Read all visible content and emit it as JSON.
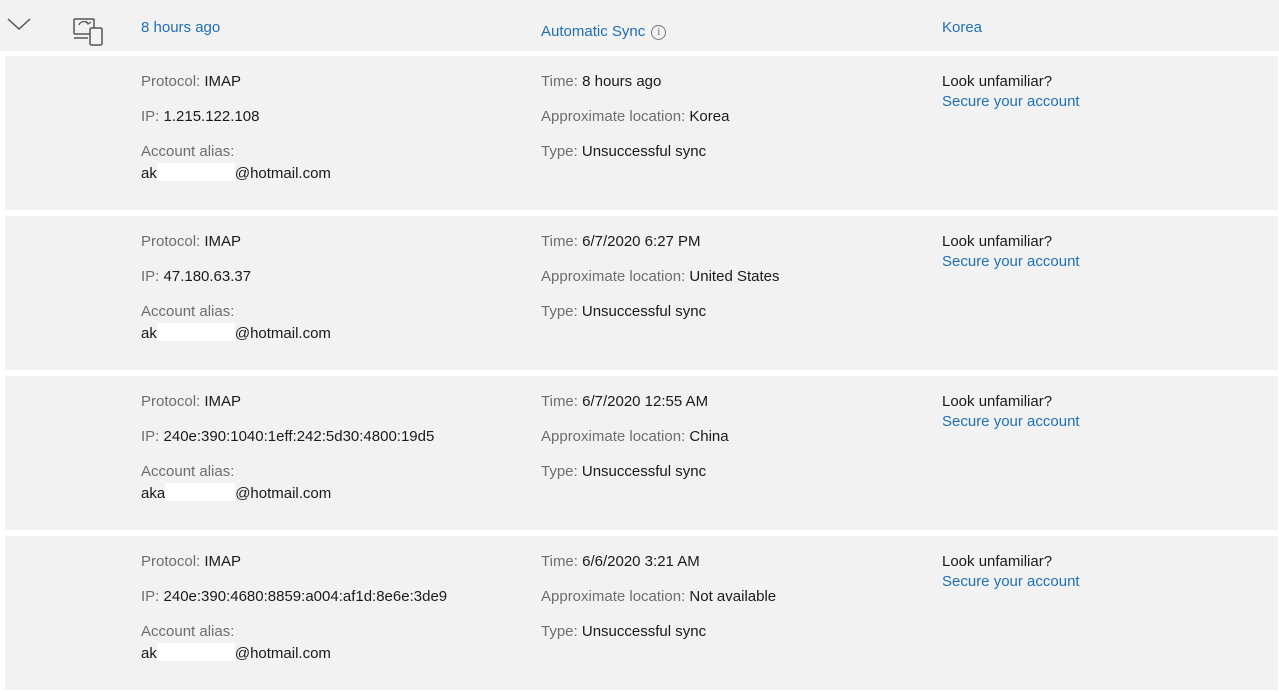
{
  "header": {
    "time": "8 hours ago",
    "activity": "Automatic Sync",
    "info_icon": "i",
    "location": "Korea"
  },
  "labels": {
    "protocol": "Protocol:",
    "ip": "IP:",
    "alias": "Account alias:",
    "time": "Time:",
    "location": "Approximate location:",
    "type": "Type:",
    "look": "Look unfamiliar?",
    "secure": "Secure your account"
  },
  "entries": [
    {
      "protocol": "IMAP",
      "ip": "1.215.122.108",
      "alias_prefix": "ak",
      "alias_suffix": "@hotmail.com",
      "time": "8 hours ago",
      "location": "Korea",
      "type": "Unsuccessful sync"
    },
    {
      "protocol": "IMAP",
      "ip": "47.180.63.37",
      "alias_prefix": "ak",
      "alias_suffix": "@hotmail.com",
      "time": "6/7/2020 6:27 PM",
      "location": "United States",
      "type": "Unsuccessful sync"
    },
    {
      "protocol": "IMAP",
      "ip": "240e:390:1040:1eff:242:5d30:4800:19d5",
      "alias_prefix": "aka",
      "alias_suffix": "@hotmail.com",
      "time": "6/7/2020 12:55 AM",
      "location": "China",
      "type": "Unsuccessful sync"
    },
    {
      "protocol": "IMAP",
      "ip": "240e:390:4680:8859:a004:af1d:8e6e:3de9",
      "alias_prefix": "ak",
      "alias_suffix": "@hotmail.com",
      "time": "6/6/2020 3:21 AM",
      "location": "Not available",
      "type": "Unsuccessful sync"
    }
  ]
}
